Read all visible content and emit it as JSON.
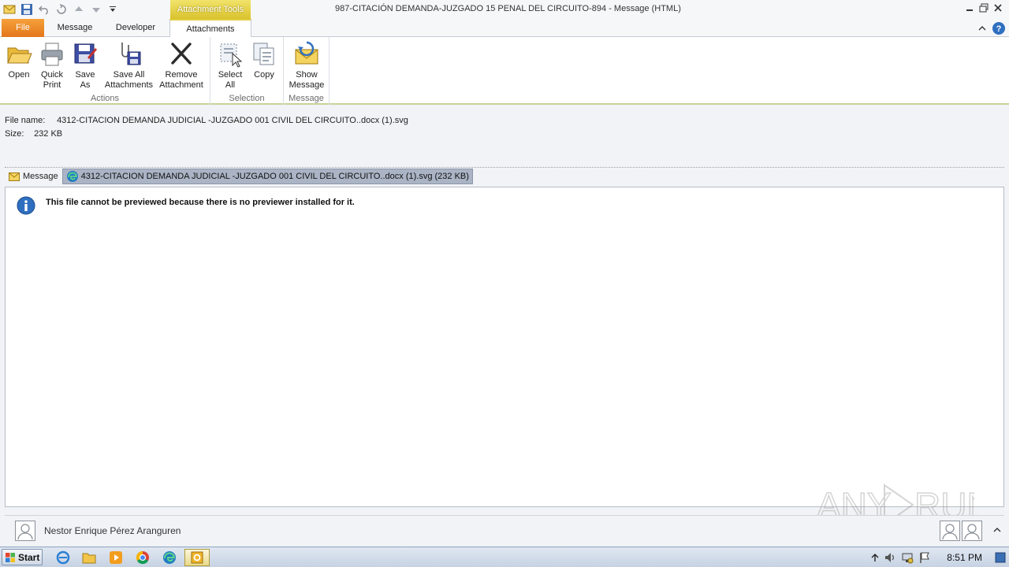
{
  "window": {
    "title": "987-CITACIÓN  DEMANDA-JUZGADO 15 PENAL DEL CIRCUITO-894 -  Message (HTML)",
    "context_tab_header": "Attachment Tools"
  },
  "tabs": {
    "file": "File",
    "message": "Message",
    "developer": "Developer",
    "attachments": "Attachments"
  },
  "ribbon": {
    "actions": {
      "label": "Actions",
      "open": "Open",
      "quick_print_1": "Quick",
      "quick_print_2": "Print",
      "save_as_1": "Save",
      "save_as_2": "As",
      "save_all_1": "Save All",
      "save_all_2": "Attachments",
      "remove_1": "Remove",
      "remove_2": "Attachment"
    },
    "selection": {
      "label": "Selection",
      "select_all_1": "Select",
      "select_all_2": "All",
      "copy": "Copy"
    },
    "message": {
      "label": "Message",
      "show_1": "Show",
      "show_2": "Message"
    }
  },
  "file_info": {
    "name_label": "File name:",
    "name_value": "4312-CITACION  DEMANDA JUDICIAL -JUZGADO 001 CIVIL DEL CIRCUITO..docx (1).svg",
    "size_label": "Size:",
    "size_value": "232 KB"
  },
  "attachments_strip": {
    "message_label": "Message",
    "file_label": "4312-CITACION  DEMANDA JUDICIAL -JUZGADO 001 CIVIL DEL CIRCUITO..docx (1).svg (232 KB)"
  },
  "preview": {
    "message": "This file cannot be previewed because there is no previewer installed for it."
  },
  "people_pane": {
    "name": "Nestor Enrique Pérez Aranguren"
  },
  "watermark": "ANY RUN",
  "taskbar": {
    "start": "Start",
    "clock": "8:51 PM"
  },
  "colors": {
    "file_tab": "#e3761b",
    "context_tab": "#e0cd40",
    "selected_attachment": "#aab4c5",
    "info_icon": "#2f6fc0"
  }
}
